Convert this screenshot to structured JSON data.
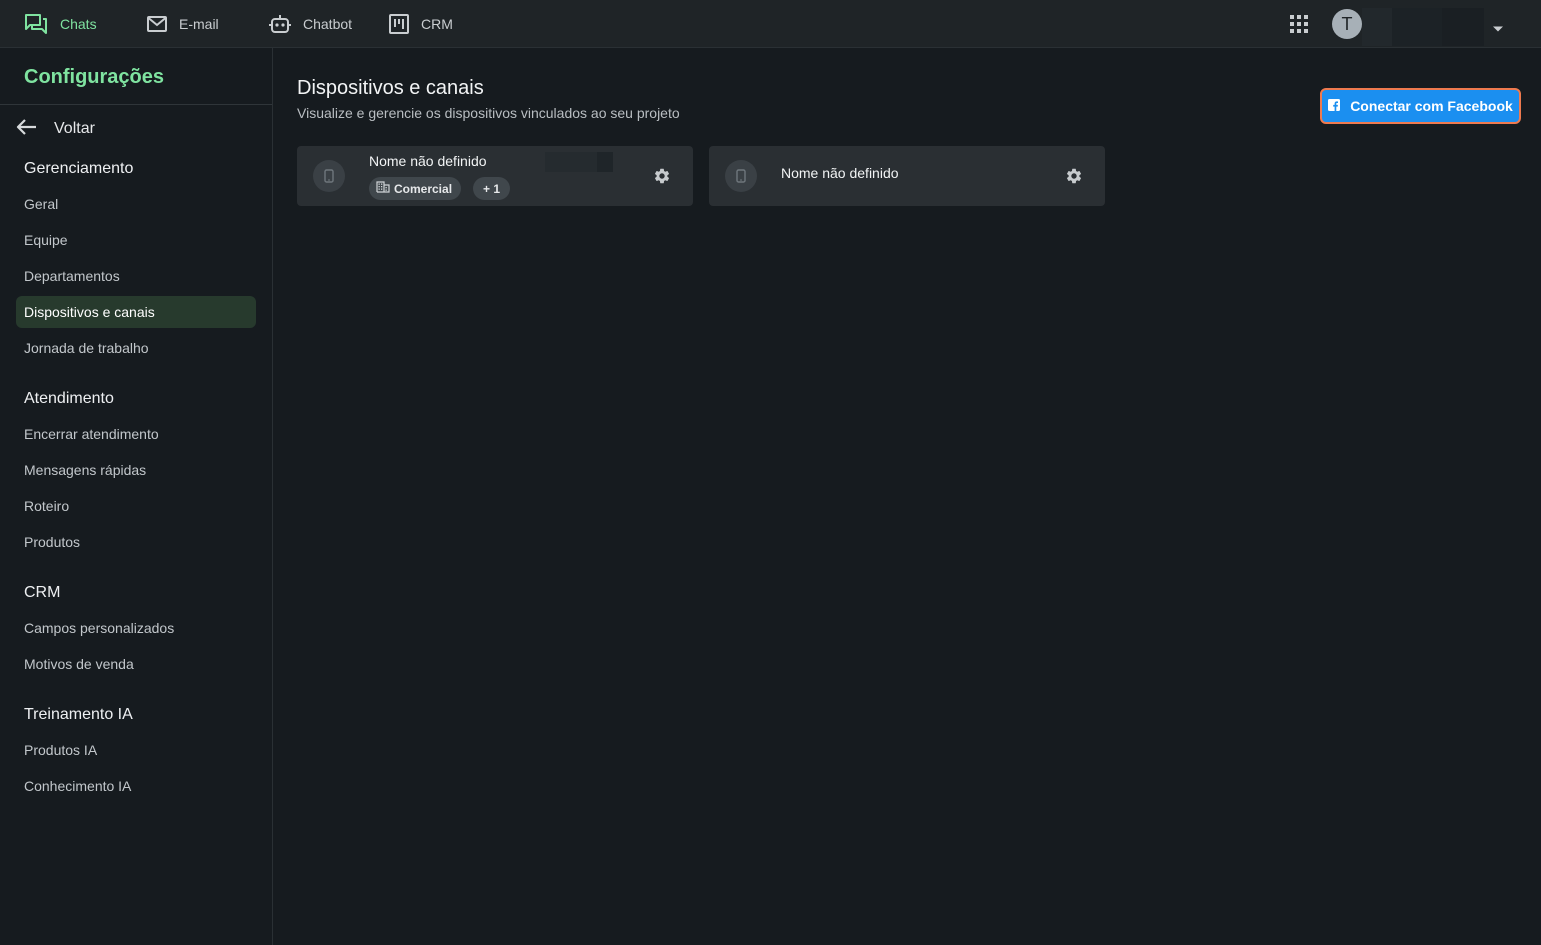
{
  "topnav": {
    "items": [
      {
        "label": "Chats",
        "icon": "chat-bubbles-icon"
      },
      {
        "label": "E-mail",
        "icon": "mail-icon"
      },
      {
        "label": "Chatbot",
        "icon": "robot-icon"
      },
      {
        "label": "CRM",
        "icon": "kanban-icon"
      }
    ],
    "avatar_initial": "T",
    "accent_color": "#7fe3a0"
  },
  "sidebar": {
    "title": "Configurações",
    "back_label": "Voltar",
    "sections": [
      {
        "title": "Gerenciamento",
        "items": [
          "Geral",
          "Equipe",
          "Departamentos",
          "Dispositivos e canais",
          "Jornada de trabalho"
        ]
      },
      {
        "title": "Atendimento",
        "items": [
          "Encerrar atendimento",
          "Mensagens rápidas",
          "Roteiro",
          "Produtos"
        ]
      },
      {
        "title": "CRM",
        "items": [
          "Campos personalizados",
          "Motivos de venda"
        ]
      },
      {
        "title": "Treinamento IA",
        "items": [
          "Produtos IA",
          "Conhecimento IA"
        ]
      }
    ],
    "selected_item": "Dispositivos e canais"
  },
  "main": {
    "title": "Dispositivos e canais",
    "subtitle": "Visualize e gerencie os dispositivos vinculados ao seu projeto",
    "connect_button_label": "Conectar com Facebook",
    "devices": [
      {
        "name": "Nome não definido",
        "tag": "Comercial",
        "extra": "+ 1"
      },
      {
        "name": "Nome não definido"
      }
    ]
  }
}
